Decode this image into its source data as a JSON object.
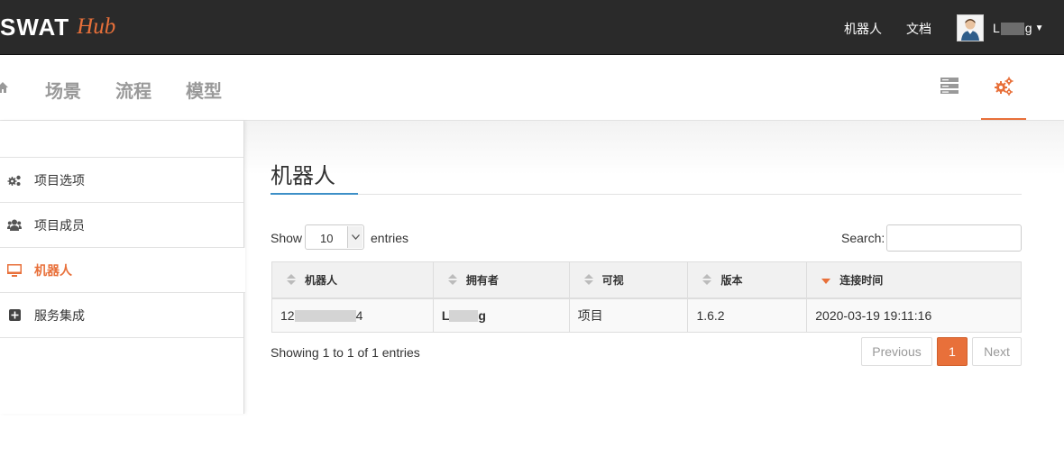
{
  "brand": {
    "name": "SWAT",
    "sub": "Hub",
    "accent": "#e8703a"
  },
  "topnav": {
    "robots": "机器人",
    "docs": "文档",
    "user": "L",
    "user_tail": "g"
  },
  "subnav": {
    "items": [
      "场景",
      "流程",
      "模型"
    ]
  },
  "sidebar": {
    "items": [
      {
        "label": "项目选项",
        "icon": "gears-icon"
      },
      {
        "label": "项目成员",
        "icon": "users-icon"
      },
      {
        "label": "机器人",
        "icon": "monitor-icon"
      },
      {
        "label": "服务集成",
        "icon": "plus-square-icon"
      }
    ],
    "active": 2
  },
  "page": {
    "title": "机器人"
  },
  "table_controls": {
    "show": "Show",
    "page_length": "10",
    "entries": "entries",
    "search_label": "Search:",
    "search_value": ""
  },
  "table": {
    "columns": [
      "机器人",
      "拥有者",
      "可视",
      "版本",
      "连接时间"
    ],
    "sorted_column": 4,
    "rows": [
      {
        "robot": "12",
        "robot_tail": "4",
        "owner": "L",
        "owner_tail": "g",
        "visibility": "项目",
        "version": "1.6.2",
        "connected": "2020-03-19 19:11:16"
      }
    ]
  },
  "footer": {
    "info": "Showing 1 to 1 of 1 entries",
    "previous": "Previous",
    "page": "1",
    "next": "Next"
  }
}
